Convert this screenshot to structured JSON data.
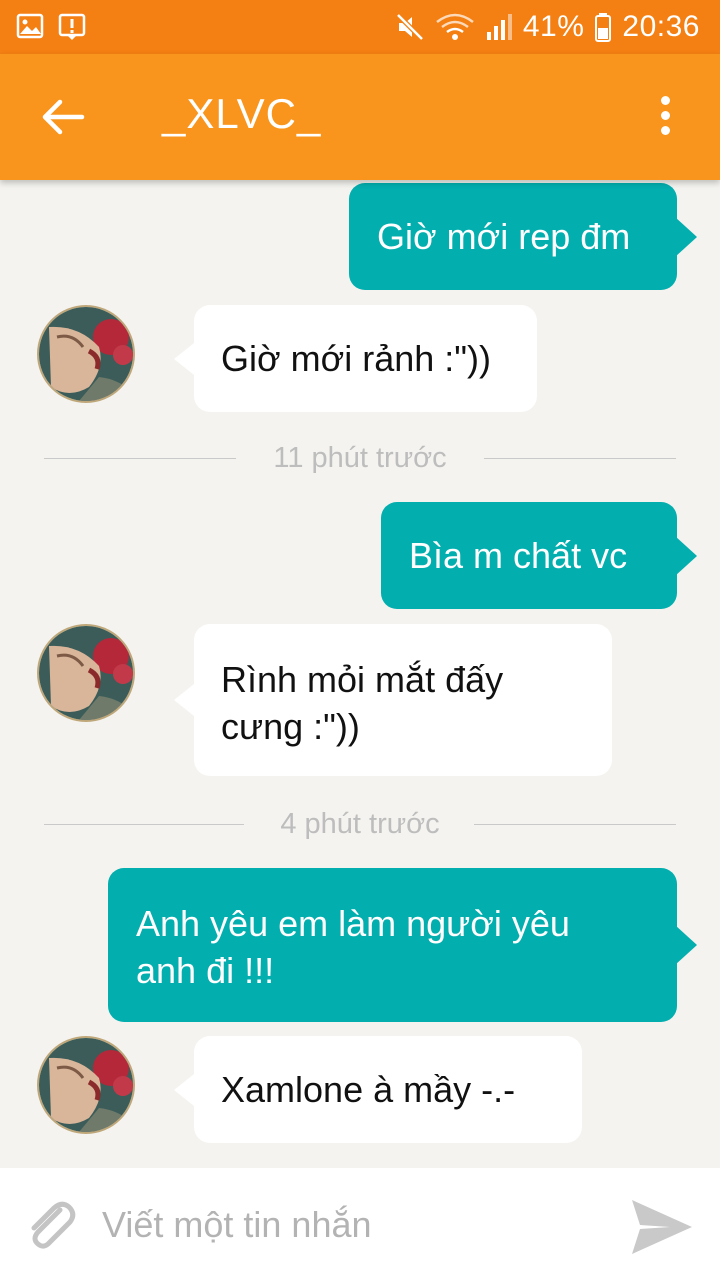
{
  "status_bar": {
    "battery": "41%",
    "time": "20:36",
    "icons": [
      "image-icon",
      "alert-icon",
      "mute-icon",
      "wifi-icon",
      "signal-icon",
      "battery-icon"
    ]
  },
  "header": {
    "title": "_XLVC_",
    "back_icon": "arrow-left-icon",
    "menu_icon": "more-vert-icon"
  },
  "messages": [
    {
      "dir": "out",
      "text": "Giờ mới rep đm"
    },
    {
      "dir": "in",
      "text": "Giờ mới rảnh :\"))"
    },
    {
      "type": "time",
      "text": "11 phút trước"
    },
    {
      "dir": "out",
      "text": "Bìa m chất vc"
    },
    {
      "dir": "in",
      "text": "Rình mỏi mắt đấy cưng :\"))"
    },
    {
      "type": "time",
      "text": "4 phút trước"
    },
    {
      "dir": "out",
      "text": "Anh yêu em làm người yêu anh đi !!!"
    },
    {
      "dir": "in",
      "text": "Xamlone à mầy -.-"
    }
  ],
  "composer": {
    "placeholder": "Viết một tin nhắn",
    "attach_icon": "paperclip-icon",
    "send_icon": "send-icon"
  },
  "colors": {
    "status_bar": "#f47f12",
    "app_bar": "#f9951c",
    "outgoing_bubble": "#03aeaf",
    "incoming_bubble": "#ffffff",
    "background": "#f4f3ef"
  }
}
